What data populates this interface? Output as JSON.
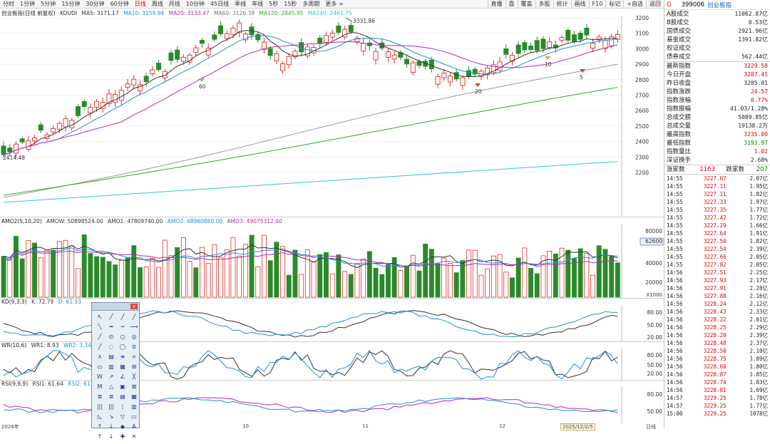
{
  "toolbar": {
    "periods": [
      "分时",
      "1分钟",
      "5分钟",
      "15分钟",
      "30分钟",
      "60分钟",
      "日线",
      "周线",
      "月线",
      "10分钟",
      "45日线",
      "季线",
      "年线",
      "5秒",
      "15秒",
      "多周期",
      "更多 >"
    ],
    "active_period": "日线",
    "right_buttons": [
      "盘",
      "覆盖",
      "多股",
      "统计",
      "画线",
      "F10",
      "标记",
      "+自选",
      "返回"
    ],
    "right_first_button": "直播"
  },
  "main_chart": {
    "legend_title": "创业板指(日线 前复权)",
    "legend_koudi": "KOUDI",
    "ma5": "MA5: 3171.17",
    "ma10": "MA10: 3159.94",
    "ma20": "MA20: 3133.47",
    "ma60": "MA60: 3126.38",
    "ma120": "MA120: 2845.95",
    "ma240": "MA240: 2461.75",
    "high_marker": "3331.86",
    "low_marker": "2414.48",
    "markers": [
      "60",
      "10",
      "5",
      "20"
    ],
    "y_axis": [
      "3200",
      "3100",
      "3000",
      "2900",
      "2800",
      "2700",
      "2600",
      "2500",
      "2400",
      "2300",
      "2200"
    ],
    "colors": {
      "ma5": "#333333",
      "ma10": "#1e8fe0",
      "ma20": "#b52ab5",
      "ma60": "#9a9a9a",
      "ma120": "#3aa33a",
      "ma240": "#2cc6d6",
      "up": "#e0302a",
      "down": "#2a8a2a"
    }
  },
  "amo_chart": {
    "legend": "AMO2(5,10,20)",
    "amow": "AMOW: 50898524.00",
    "amo1": "AMO1: 47809740.00",
    "amo2": "AMO2: 48960880.00",
    "amo3": "AMO3: 49075312.00",
    "y_axis": [
      "80000",
      "62600",
      "40000",
      "20000"
    ],
    "scale": "X1000"
  },
  "kd_chart": {
    "legend": "KD(9,3,3)",
    "k": "K: 72.79",
    "d": "D: 61.33",
    "y_axis": [
      "80.00",
      "50.00",
      "20.00"
    ]
  },
  "wr_chart": {
    "legend": "WR(10,6)",
    "wr1": "WR1: 8.93",
    "wr2": "WR2: 3.34",
    "y_axis": [
      "80.00",
      "50.00",
      "20.00"
    ]
  },
  "rsi_chart": {
    "legend": "RSI(9,9,9)",
    "rsi1": "RSI1: 61.64",
    "rsi2": "RSI2: 61.64",
    "y_axis": [
      "80.00",
      "50.00"
    ]
  },
  "x_axis": {
    "labels": [
      "2026年",
      "10",
      "11",
      "12",
      "2025/12/2/5"
    ],
    "right_label": "日线"
  },
  "right_panel": {
    "g": "G",
    "code": "399006",
    "name": "创业板指",
    "rows1": [
      {
        "k": "A股成交",
        "v": "11062.87亿",
        "c": ""
      },
      {
        "k": "B股成交",
        "v": "0.53亿",
        "c": ""
      },
      {
        "k": "国债成交",
        "v": "2921.96亿",
        "c": ""
      },
      {
        "k": "基金成交",
        "v": "1391.82亿",
        "c": ""
      },
      {
        "k": "权证成交",
        "v": "",
        "c": ""
      },
      {
        "k": "债券成交",
        "v": "562.44亿",
        "c": ""
      }
    ],
    "rows2": [
      {
        "k": "最新指数",
        "v": "3229.58",
        "c": "red"
      },
      {
        "k": "今日开盘",
        "v": "3207.41",
        "c": "red"
      },
      {
        "k": "昨日收盘",
        "v": "3205.01",
        "c": ""
      },
      {
        "k": "指数涨跌",
        "v": "24.57",
        "c": "red"
      },
      {
        "k": "指数涨幅",
        "v": "0.77%",
        "c": "red"
      },
      {
        "k": "指数振幅",
        "v": "41.03/1.28%",
        "c": ""
      },
      {
        "k": "总成交额",
        "v": "5089.85亿",
        "c": ""
      },
      {
        "k": "总成交量",
        "v": "19138.2万",
        "c": ""
      },
      {
        "k": "最高指数",
        "v": "3235.00",
        "c": "red"
      },
      {
        "k": "最低指数",
        "v": "3193.97",
        "c": "green"
      },
      {
        "k": "指数量比",
        "v": "1.02",
        "c": "red"
      },
      {
        "k": "深证换手",
        "v": "2.68%",
        "c": ""
      }
    ],
    "updown": {
      "up_label": "涨家数",
      "up": "1163",
      "down_label": "跌家数",
      "down": "207"
    },
    "ticks": [
      {
        "t": "14:55",
        "p": "3227.07",
        "v": "2.07亿"
      },
      {
        "t": "14:55",
        "p": "3227.11",
        "v": "1.95亿"
      },
      {
        "t": "14:55",
        "p": "3227.11",
        "v": "1.82亿"
      },
      {
        "t": "14:55",
        "p": "3227.33",
        "v": "1.97亿"
      },
      {
        "t": "14:55",
        "p": "3227.35",
        "v": "1.77亿"
      },
      {
        "t": "14:55",
        "p": "3227.42",
        "v": "1.72亿"
      },
      {
        "t": "14:55",
        "p": "3227.29",
        "v": "1.66亿"
      },
      {
        "t": "14:55",
        "p": "3227.64",
        "v": "1.91亿"
      },
      {
        "t": "14:55",
        "p": "3227.50",
        "v": "1.82亿"
      },
      {
        "t": "14:55",
        "p": "3227.54",
        "v": "2.39亿"
      },
      {
        "t": "14:55",
        "p": "3227.66",
        "v": "2.05亿"
      },
      {
        "t": "14:55",
        "p": "3227.82",
        "v": "2.05亿"
      },
      {
        "t": "14:56",
        "p": "3227.51",
        "v": "2.25亿"
      },
      {
        "t": "14:56",
        "p": "3227.93",
        "v": "2.17亿"
      },
      {
        "t": "14:56",
        "p": "3227.91",
        "v": "2.28亿"
      },
      {
        "t": "14:56",
        "p": "3227.88",
        "v": "2.16亿"
      },
      {
        "t": "14:56",
        "p": "3228.24",
        "v": "2.12亿"
      },
      {
        "t": "14:56",
        "p": "3228.43",
        "v": "2.33亿"
      },
      {
        "t": "14:56",
        "p": "3228.22",
        "v": "2.01亿"
      },
      {
        "t": "14:56",
        "p": "3228.25",
        "v": "2.29亿"
      },
      {
        "t": "14:56",
        "p": "3228.20",
        "v": "2.39亿"
      },
      {
        "t": "14:56",
        "p": "3228.48",
        "v": "2.37亿"
      },
      {
        "t": "14:56",
        "p": "3228.50",
        "v": "2.10亿"
      },
      {
        "t": "14:56",
        "p": "3228.75",
        "v": "1.89亿"
      },
      {
        "t": "14:56",
        "p": "3228.60",
        "v": "1.80亿"
      },
      {
        "t": "14:56",
        "p": "3228.87",
        "v": "1.85亿"
      },
      {
        "t": "14:56",
        "p": "3228.74",
        "v": "1.83亿"
      },
      {
        "t": "14:56",
        "p": "3228.81",
        "v": "1.69亿"
      },
      {
        "t": "14:57",
        "p": "3229.25",
        "v": "1.78亿"
      },
      {
        "t": "14:57",
        "p": "3229.25",
        "v": "1.77亿"
      },
      {
        "t": "15:00",
        "p": "3229.25",
        "v": "1078亿"
      }
    ]
  },
  "draw_tools": {
    "close_label": "x",
    "tools": [
      "↖",
      "╱",
      "╱",
      "╱",
      "╲",
      "━",
      "┅",
      "⟶",
      "╱",
      "⊙",
      "○",
      "◎",
      "╱",
      "◌",
      "◯",
      "⊘",
      "∧",
      "▤",
      "≡",
      "⌗",
      "▭",
      "▥",
      "▦",
      "⊞",
      "W",
      "↗",
      "∠",
      "╳",
      "M",
      "△",
      "▣",
      "⊠",
      "≣",
      "≣",
      "▤",
      "▦",
      "|||",
      "|||",
      "¦",
      "▥",
      "◺",
      "↘",
      "▽",
      "▭",
      "↑",
      "↓",
      "◆",
      "A",
      "↑",
      "↓",
      "✚",
      "✕"
    ]
  }
}
